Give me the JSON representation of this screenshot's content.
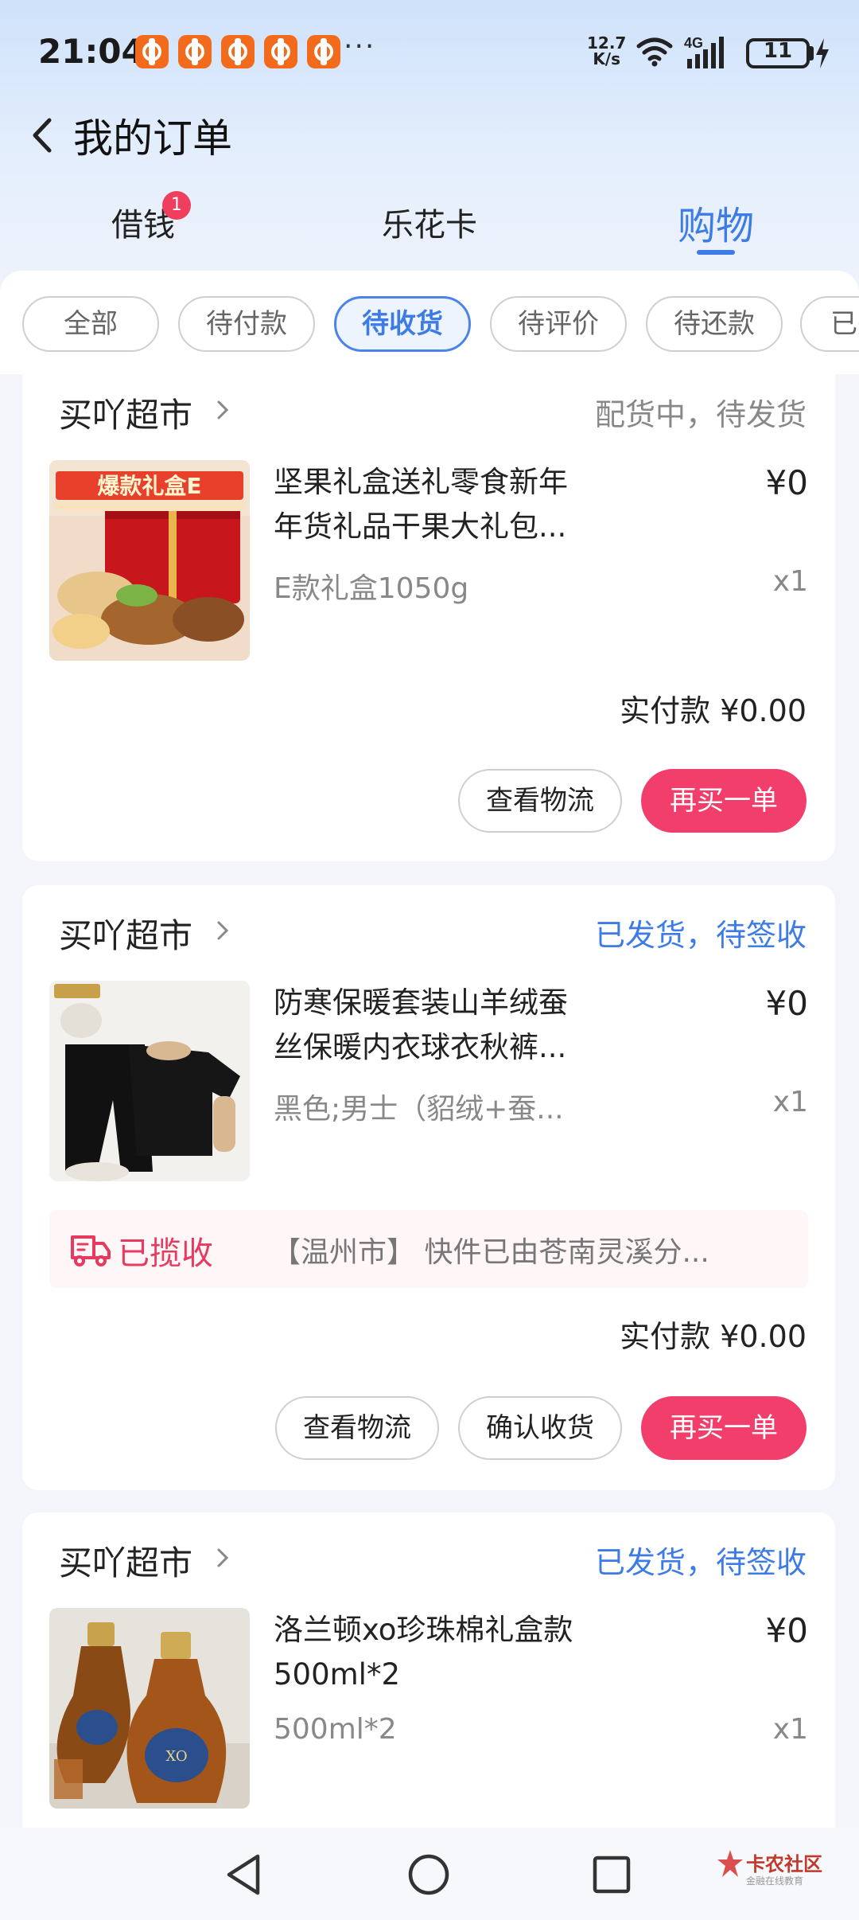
{
  "status_bar": {
    "time": "21:04",
    "more": "···",
    "net_speed_value": "12.7",
    "net_speed_unit": "K/s",
    "network": "4G",
    "battery": "11"
  },
  "header": {
    "title": "我的订单",
    "tabs": [
      {
        "label": "借钱",
        "badge": "1"
      },
      {
        "label": "乐花卡"
      },
      {
        "label": "购物"
      }
    ]
  },
  "filters": [
    "全部",
    "待付款",
    "待收货",
    "待评价",
    "待还款",
    "已完"
  ],
  "orders": [
    {
      "shop": "买吖超市",
      "status": "配货中，待发货",
      "product_name": "坚果礼盒送礼零食新年年货礼品干果大礼包...",
      "product_line1": "坚果礼盒送礼零食新年",
      "product_line2": "年货礼品干果大礼包...",
      "price": "¥0",
      "variant": "E款礼盒1050g",
      "qty": "x1",
      "thumb_text": "爆款礼盒E",
      "paid": "实付款 ¥0.00",
      "buttons": {
        "logistics": "查看物流",
        "rebuy": "再买一单"
      }
    },
    {
      "shop": "买吖超市",
      "status": "已发货，待签收",
      "product_line1": "防寒保暖套装山羊绒蚕",
      "product_line2": "丝保暖内衣球衣秋裤...",
      "price": "¥0",
      "variant": "黑色;男士（貂绒+蚕...",
      "qty": "x1",
      "logistics_status": "已揽收",
      "logistics_text": "【温州市】 快件已由苍南灵溪分...",
      "paid": "实付款 ¥0.00",
      "buttons": {
        "logistics": "查看物流",
        "confirm": "确认收货",
        "rebuy": "再买一单"
      }
    },
    {
      "shop": "买吖超市",
      "status": "已发货，待签收",
      "product_line1": "洛兰顿xo珍珠棉礼盒款",
      "product_line2": "500ml*2",
      "price": "¥0",
      "variant": "500ml*2",
      "qty": "x1"
    }
  ],
  "watermark": {
    "title": "卡农社区",
    "subtitle": "金融在线教育"
  },
  "colors": {
    "accent": "#3d7be6",
    "primary_button": "#f23e6a",
    "logistics": "#e8395f"
  }
}
